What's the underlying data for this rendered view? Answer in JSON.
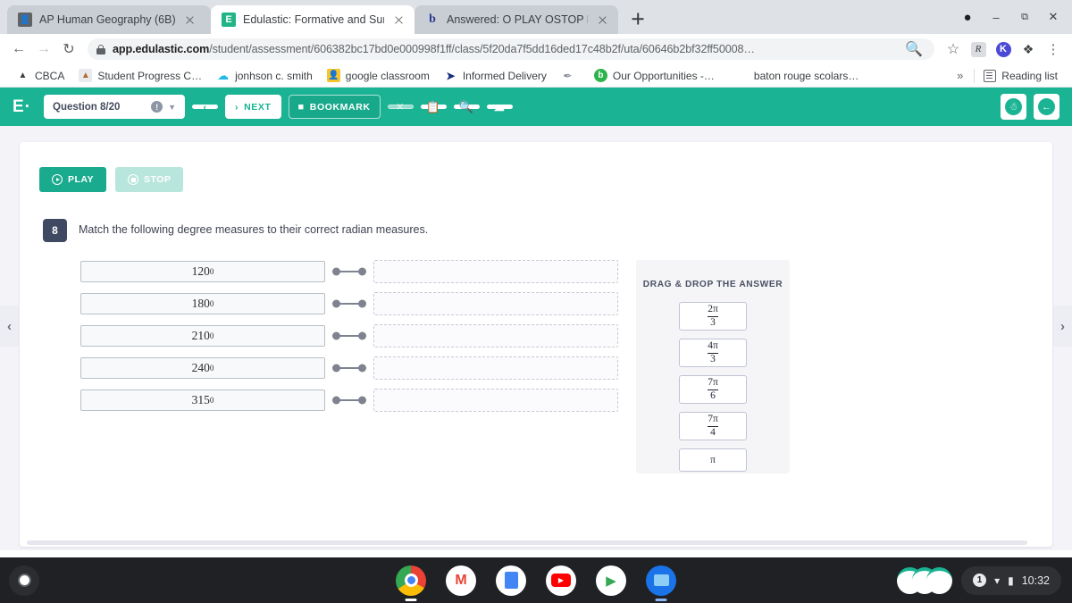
{
  "browser": {
    "tabs": [
      {
        "title": "AP Human Geography (6B)",
        "favicon": "contacts-icon",
        "active": false
      },
      {
        "title": "Edulastic: Formative and Summa",
        "favicon": "edulastic-icon",
        "active": true
      },
      {
        "title": "Answered: O PLAY OSTOP Find t",
        "favicon": "bartleby-icon",
        "active": false
      }
    ],
    "new_tab_label": "+",
    "window_controls": {
      "minimize": "–",
      "maximize": "❐",
      "close": "✕",
      "profile": "profile-avatar-icon"
    },
    "nav": {
      "back": "←",
      "forward": "→",
      "reload": "↻"
    },
    "omnibox": {
      "host": "app.edulastic.com",
      "path": "/student/assessment/606382bc17bd0e000998f1ff/class/5f20da7f5dd16ded17c48b2f/uta/60646b2bf32ff50008…",
      "lock": "lock-icon",
      "zoom_icon": "zoom-out-icon",
      "star_icon": "bookmark-star-icon"
    },
    "extensions": [
      {
        "name": "grammar-extension-icon",
        "glyph": "R"
      },
      {
        "name": "kami-extension-icon",
        "glyph": "K"
      },
      {
        "name": "extensions-puzzle-icon",
        "glyph": "❖"
      },
      {
        "name": "chrome-menu-icon",
        "glyph": "⋮"
      }
    ],
    "bookmarks": [
      {
        "label": "CBCA",
        "icon": "cbca-icon"
      },
      {
        "label": "Student Progress C…",
        "icon": "student-progress-icon"
      },
      {
        "label": "jonhson c. smith",
        "icon": "cloud-blue-icon"
      },
      {
        "label": "google classroom",
        "icon": "classroom-icon"
      },
      {
        "label": "Informed Delivery",
        "icon": "usps-icon"
      },
      {
        "label": "",
        "icon": "feather-icon"
      },
      {
        "label": "Our Opportunities -…",
        "icon": "bitly-icon"
      },
      {
        "label": "baton rouge scolars…",
        "icon": "none"
      }
    ],
    "overflow_label": "»",
    "reading_list_label": "Reading list"
  },
  "edulastic_bar": {
    "logo": "E·",
    "question_label": "Question 8/20",
    "info_icon": "info-icon",
    "chevron_icon": "chevron-down-icon",
    "prev_label": "‹",
    "next_label": "NEXT",
    "next_arrow": "›",
    "bookmark_label": "BOOKMARK",
    "bookmark_icon": "bookmark-flag-icon",
    "close_icon": "✕",
    "calculator_icon": "calculator-icon",
    "magnify_icon": "magnifier-icon",
    "cloud_icon": "cloud-save-icon",
    "accessibility_icon": "accessibility-icon",
    "exit_icon": "exit-icon"
  },
  "question": {
    "play_label": "PLAY",
    "stop_label": "STOP",
    "number": "8",
    "prompt": "Match the following degree measures to their correct radian measures.",
    "left_items": [
      {
        "value": "120",
        "sup": "0"
      },
      {
        "value": "180",
        "sup": "0"
      },
      {
        "value": "210",
        "sup": "0"
      },
      {
        "value": "240",
        "sup": "0"
      },
      {
        "value": "315",
        "sup": "0"
      }
    ],
    "drop_zones": [
      "",
      "",
      "",
      "",
      ""
    ],
    "dragdrop": {
      "title": "DRAG & DROP THE ANSWER",
      "options": [
        {
          "numerator": "2π",
          "denominator": "3"
        },
        {
          "numerator": "4π",
          "denominator": "3"
        },
        {
          "numerator": "7π",
          "denominator": "6"
        },
        {
          "numerator": "7π",
          "denominator": "4"
        },
        {
          "plain": "π"
        }
      ]
    },
    "page_prev_arrow": "‹",
    "page_next_arrow": "›"
  },
  "shelf": {
    "launcher_icon": "launcher-icon",
    "apps": [
      {
        "name": "chrome-app-icon"
      },
      {
        "name": "gmail-app-icon"
      },
      {
        "name": "docs-app-icon"
      },
      {
        "name": "youtube-app-icon"
      },
      {
        "name": "play-store-app-icon"
      },
      {
        "name": "files-app-icon"
      }
    ],
    "status": {
      "notification_count": "1",
      "wifi_icon": "wifi-icon",
      "battery_icon": "battery-icon",
      "time": "10:32"
    }
  },
  "colors": {
    "edulastic_green": "#1ab394",
    "dark_navy": "#3f4961",
    "page_bg": "#f3f3f8"
  }
}
